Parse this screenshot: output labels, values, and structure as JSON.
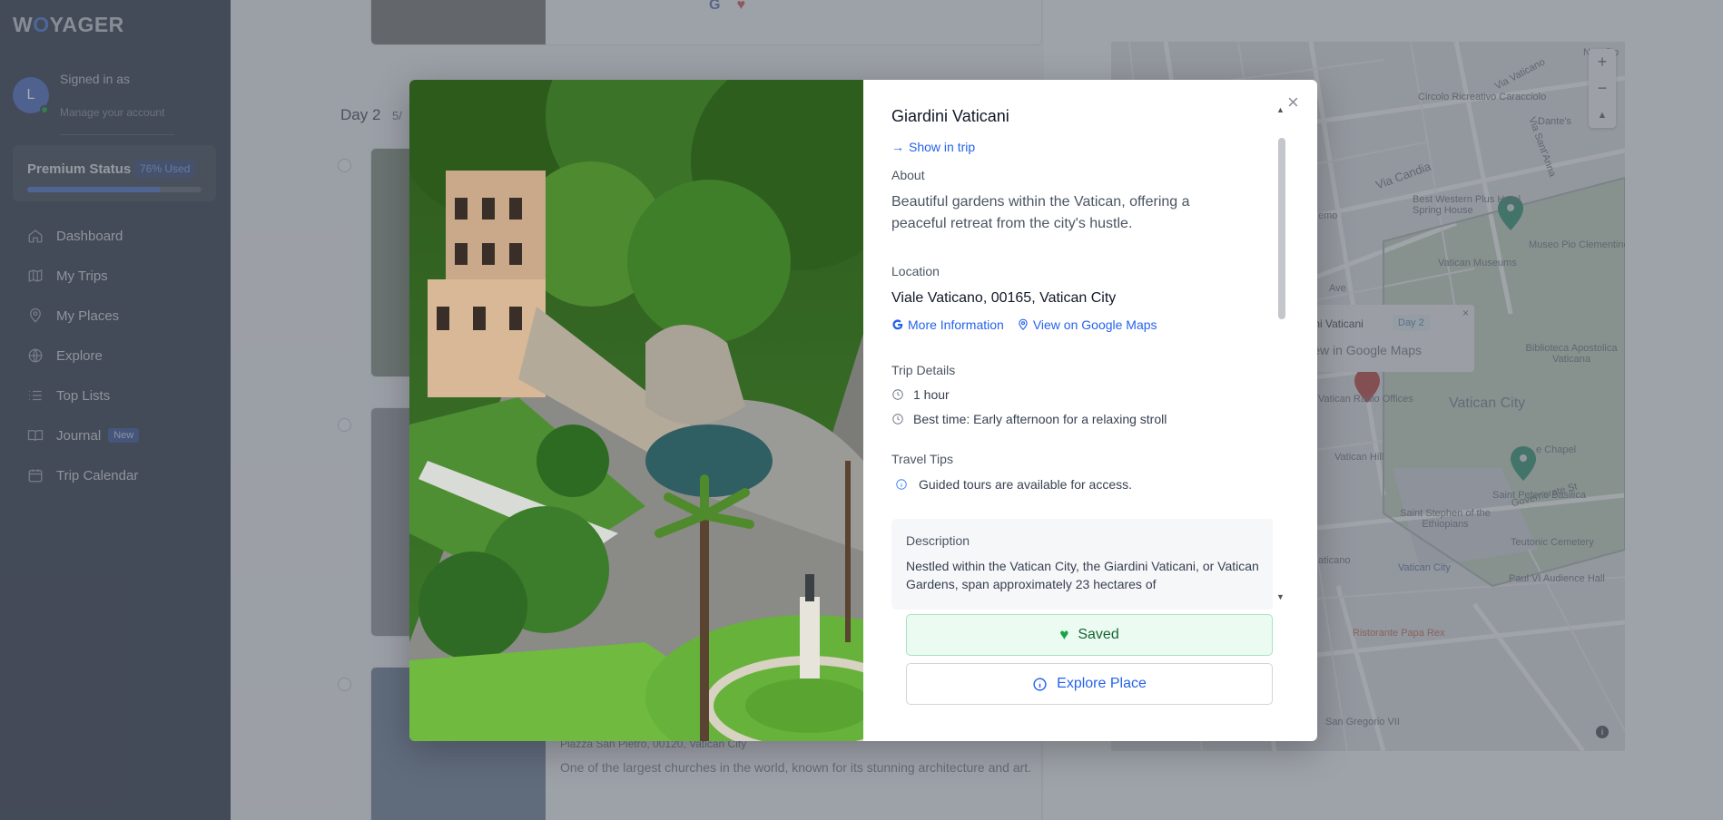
{
  "app": {
    "logo_prefix": "W",
    "logo_o": "O",
    "logo_suffix": "YAGER"
  },
  "user": {
    "initial": "L",
    "signed_in_label": "Signed in as",
    "manage_label": "Manage your account"
  },
  "premium": {
    "label": "Premium Status",
    "badge": "76% Used",
    "used_percent": 76
  },
  "nav": [
    {
      "label": "Dashboard",
      "icon": "home-icon"
    },
    {
      "label": "My Trips",
      "icon": "map-icon"
    },
    {
      "label": "My Places",
      "icon": "map-pin-icon"
    },
    {
      "label": "Explore",
      "icon": "globe-icon"
    },
    {
      "label": "Top Lists",
      "icon": "list-icon"
    },
    {
      "label": "Journal",
      "icon": "book-icon",
      "badge": "New"
    },
    {
      "label": "Trip Calendar",
      "icon": "calendar-icon"
    }
  ],
  "background": {
    "day_title": "Day 2",
    "day_sub": "5/",
    "card_text": "One of the largest churches in the world, known for its stunning architecture and art.",
    "card_addr": "Piazza San Pietro, 00120, Vatican City"
  },
  "map": {
    "labels": {
      "circolo": "Circolo Ricreativo Caracciolo",
      "via_candia": "Via Candia",
      "best_western": "Best Western Plus Hotel Spring House",
      "vatican_museums": "Vatican Museums",
      "museo_pio": "Museo Pio Clementino",
      "biblioteca": "Biblioteca Apostolica Vaticana",
      "radio": "Vatican Radio Offices",
      "vatican_city": "Vatican City",
      "vatican_hill": "Vatican Hill",
      "chapel": "e Chapel",
      "saint_peters": "Saint Peter's Basilica",
      "stephen": "Saint Stephen of the Ethiopians",
      "teutonic": "Teutonic Cemetery",
      "vatican_city_station": "Vatican City",
      "paul_vi": "Paul VI Audience Hall",
      "papa_rex": "Ristorante Papa Rex",
      "san_gregorio": "San Gregorio VII",
      "via_sant": "Via Sant'Anna",
      "dante": "Dante's",
      "via_vaticano": "Via Vaticano",
      "new_do": "New Do",
      "ave": "Ave",
      "gov": "Governorate St",
      "aticano": "aticano",
      "emo": "emo"
    },
    "popup": {
      "title": "rdini Vaticani",
      "day": "Day 2",
      "link": "View in Google Maps",
      "close": "×"
    },
    "zoom_in": "+",
    "zoom_out": "−"
  },
  "modal": {
    "title": "Giardini Vaticani",
    "show_in_trip": "Show in trip",
    "about_label": "About",
    "about_text": "Beautiful gardens within the Vatican, offering a peaceful retreat from the city's hustle.",
    "location_label": "Location",
    "location_text": "Viale Vaticano, 00165, Vatican City",
    "more_info": "More Information",
    "google_maps": "View on Google Maps",
    "trip_details_label": "Trip Details",
    "duration": "1 hour",
    "best_time": "Best time: Early afternoon for a relaxing stroll",
    "travel_tips_label": "Travel Tips",
    "tip": "Guided tours are available for access.",
    "description_label": "Description",
    "description_text": "Nestled within the Vatican City, the Giardini Vaticani, or Vatican Gardens, span approximately 23 hectares of",
    "saved_button": "Saved",
    "explore_button": "Explore Place",
    "close": "×"
  },
  "colors": {
    "accent": "#2563eb",
    "saved_bg": "#ecfbf1",
    "saved_text": "#166534"
  }
}
